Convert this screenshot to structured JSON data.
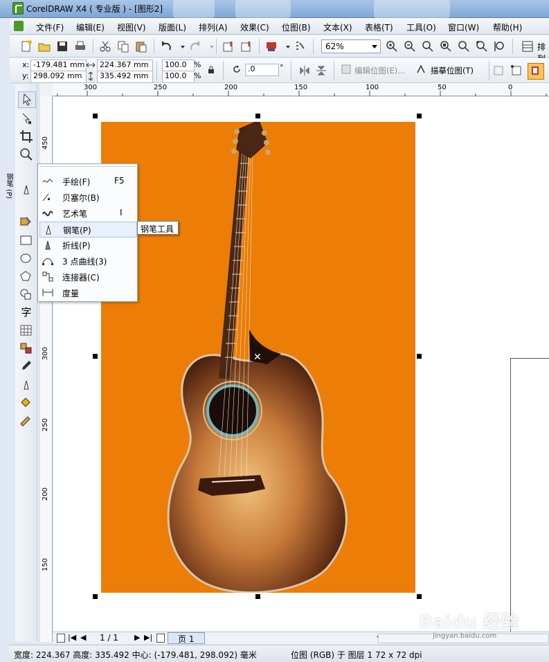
{
  "window": {
    "title": "CorelDRAW X4 ( 专业版 ) - [图形2]"
  },
  "menu": [
    "文件(F)",
    "编辑(E)",
    "视图(V)",
    "版面(L)",
    "排列(A)",
    "效果(C)",
    "位图(B)",
    "文本(X)",
    "表格(T)",
    "工具(O)",
    "窗口(W)",
    "帮助(H)"
  ],
  "toolbar": {
    "zoom_value": "62%",
    "arrange_label": "排列"
  },
  "propbar": {
    "x_label": "x:",
    "x_value": "-179.481 mm",
    "y_label": "y:",
    "y_value": "298.092 mm",
    "width_value": "224.367 mm",
    "height_value": "335.492 mm",
    "scale_x": "100.0",
    "scale_y": "100.0",
    "percent": "%",
    "rotation": ".0",
    "degree": "°",
    "edit_bitmap": "编辑位图(E)...",
    "trace_bitmap": "描摹位图(T)"
  },
  "toolbox": {
    "pen_vertical_label": "钢笔 (P)"
  },
  "flyout": {
    "items": [
      {
        "label": "手绘(F)",
        "key": "F5",
        "icon": "freehand-icon"
      },
      {
        "label": "贝塞尔(B)",
        "key": "",
        "icon": "bezier-icon"
      },
      {
        "label": "艺术笔",
        "key": "I",
        "icon": "artistic-media-icon"
      },
      {
        "label": "钢笔(P)",
        "key": "",
        "icon": "pen-icon"
      },
      {
        "label": "折线(P)",
        "key": "",
        "icon": "polyline-icon"
      },
      {
        "label": "3 点曲线(3)",
        "key": "",
        "icon": "three-point-curve-icon"
      },
      {
        "label": "连接器(C)",
        "key": "",
        "icon": "connector-icon"
      },
      {
        "label": "度量",
        "key": "",
        "icon": "dimension-icon"
      }
    ],
    "tooltip": "钢笔工具"
  },
  "rulers": {
    "top": [
      "300",
      "250",
      "200",
      "150",
      "100",
      "50",
      "0"
    ],
    "left": [
      "450",
      "300",
      "250",
      "200",
      "150"
    ],
    "unit": "毫米"
  },
  "navigation": {
    "page_count": "1 / 1",
    "page_tab": "页 1"
  },
  "status": {
    "dimensions": "宽度: 224.367 高度: 335.492 中心: (-179.481, 298.092)  毫米",
    "object_info": "位图 (RGB) 于 图层 1 72 x 72 dpi"
  },
  "watermark": {
    "text": "Baidu 经验",
    "sub": "jingyan.baidu.com"
  },
  "colors": {
    "background_orange": "#ec7d06"
  }
}
